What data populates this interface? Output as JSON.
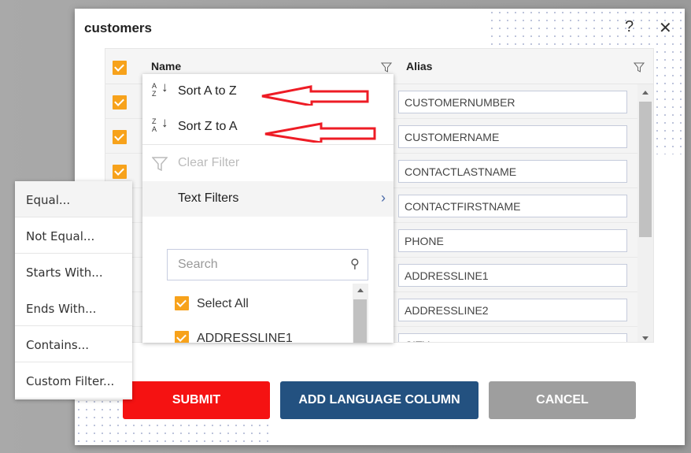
{
  "dialog": {
    "title": "customers",
    "help_icon": "question-icon",
    "close_icon": "close-icon"
  },
  "grid": {
    "columns": [
      "Name",
      "Alias"
    ],
    "aliases": [
      "CUSTOMERNUMBER",
      "CUSTOMERNAME",
      "CONTACTLASTNAME",
      "CONTACTFIRSTNAME",
      "PHONE",
      "ADDRESSLINE1",
      "ADDRESSLINE2",
      "CITY"
    ]
  },
  "filter_menu": {
    "sort_asc": "Sort A to Z",
    "sort_desc": "Sort Z to A",
    "clear_filter": "Clear Filter",
    "text_filters": "Text Filters",
    "search_placeholder": "Search",
    "select_all": "Select All",
    "items": [
      "ADDRESSLINE1"
    ]
  },
  "text_filters_submenu": [
    "Equal...",
    "Not Equal...",
    "Starts With...",
    "Ends With...",
    "Contains...",
    "Custom Filter..."
  ],
  "buttons": {
    "submit": "SUBMIT",
    "add_language": "ADD LANGUAGE COLUMN",
    "cancel": "CANCEL"
  },
  "colors": {
    "accent": "#f7a21b",
    "submit": "#f51212",
    "add_language": "#235180",
    "cancel": "#9e9e9e",
    "annotation_arrow": "#ee1c25"
  }
}
